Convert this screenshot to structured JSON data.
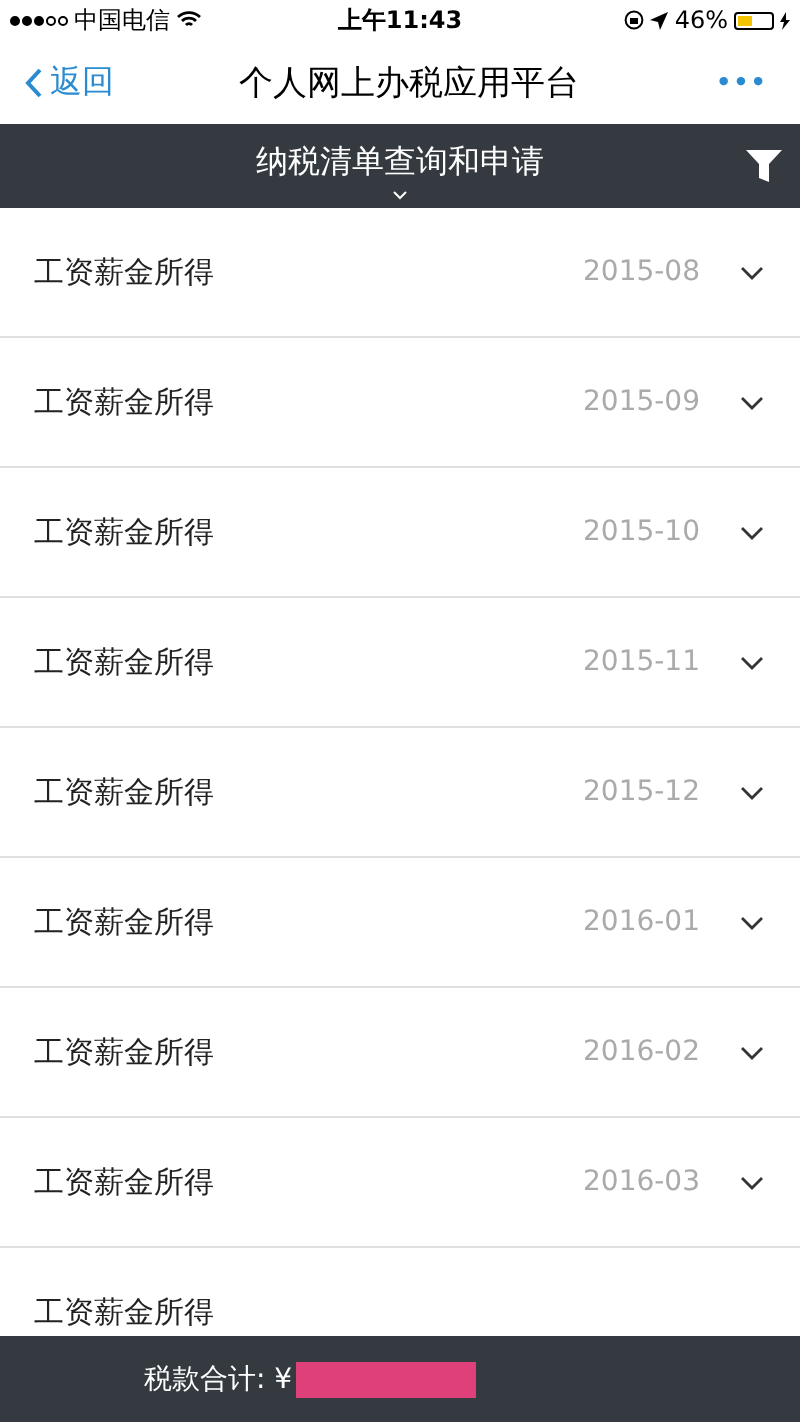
{
  "status_bar": {
    "carrier": "中国电信",
    "time": "上午11:43",
    "battery": "46%"
  },
  "nav": {
    "back": "返回",
    "title": "个人网上办税应用平台",
    "more": "•••"
  },
  "header": {
    "title": "纳税清单查询和申请"
  },
  "rows": [
    {
      "label": "工资薪金所得",
      "date": "2015-08"
    },
    {
      "label": "工资薪金所得",
      "date": "2015-09"
    },
    {
      "label": "工资薪金所得",
      "date": "2015-10"
    },
    {
      "label": "工资薪金所得",
      "date": "2015-11"
    },
    {
      "label": "工资薪金所得",
      "date": "2015-12"
    },
    {
      "label": "工资薪金所得",
      "date": "2016-01"
    },
    {
      "label": "工资薪金所得",
      "date": "2016-02"
    },
    {
      "label": "工资薪金所得",
      "date": "2016-03"
    },
    {
      "label": "工资薪金所得"
    }
  ],
  "footer": {
    "label": "税款合计: ¥",
    "amount_redacted": true
  }
}
